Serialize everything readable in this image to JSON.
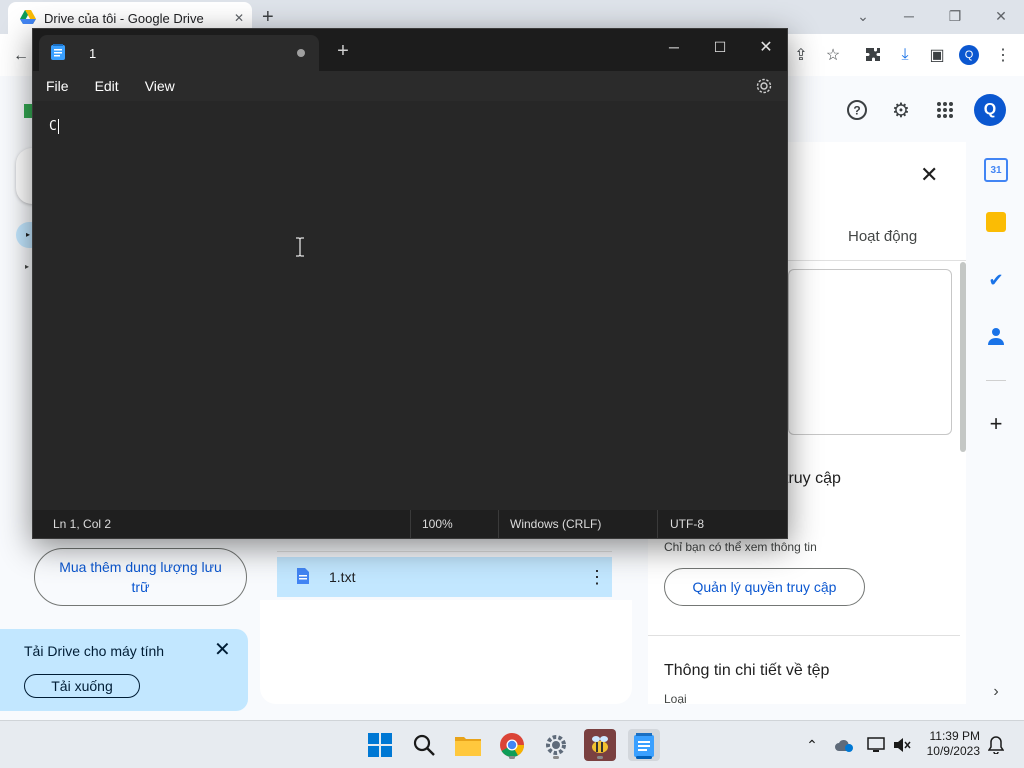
{
  "chrome": {
    "tab_title": "Drive của tôi - Google Drive",
    "tab_close": "✕",
    "new_tab": "+"
  },
  "drive": {
    "avatar_letter": "Q",
    "panel_activity_tab": "Hoạt động",
    "panel_close": "✕",
    "access_heading": "truy cập",
    "access_note": "Chỉ bạn có thể xem thông tin",
    "manage_access_button": "Quản lý quyền truy cập",
    "details_heading": "Thông tin chi tiết về tệp",
    "type_label": "Loại",
    "buy_storage_button": "Mua thêm dung lượng lưu trữ",
    "promo_text": "Tải Drive cho máy tính",
    "promo_button": "Tải xuống",
    "promo_close": "✕",
    "file_name": "1.txt",
    "file_more": "⋮",
    "rail_calendar_day": "31",
    "rail_add": "+"
  },
  "notepad": {
    "tab_label": "1",
    "new_tab": "+",
    "menu": [
      "File",
      "Edit",
      "View"
    ],
    "editor_text": "C",
    "status": {
      "position": "Ln 1, Col 2",
      "zoom": "100%",
      "line_ending": "Windows (CRLF)",
      "encoding": "UTF-8"
    }
  },
  "taskbar": {
    "time": "11:39 PM",
    "date": "10/9/2023"
  },
  "colors": {
    "notepad_bg": "#272727",
    "drive_blue": "#0b57d0",
    "selection_blue": "#c2e7ff",
    "taskbar_bg": "#e7ebf0"
  }
}
